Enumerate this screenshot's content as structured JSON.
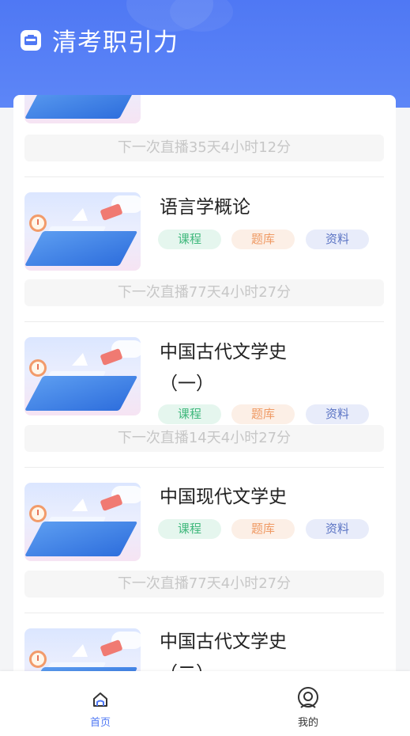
{
  "app": {
    "title": "清考职引力"
  },
  "first_countdown": "下一次直播35天4小时12分",
  "courses": [
    {
      "title": "语言学概论",
      "tags": [
        "课程",
        "题库",
        "资料"
      ],
      "countdown": "下一次直播77天4小时27分"
    },
    {
      "title": "中国古代文学史（一）",
      "tags": [
        "课程",
        "题库",
        "资料"
      ],
      "countdown": "下一次直播14天4小时27分"
    },
    {
      "title": "中国现代文学史",
      "tags": [
        "课程",
        "题库",
        "资料"
      ],
      "countdown": "下一次直播77天4小时27分"
    },
    {
      "title": "中国古代文学史（二）"
    }
  ],
  "nav": {
    "home": "首页",
    "me": "我的"
  },
  "colors": {
    "primary": "#4f78f4",
    "tag_course": "#3fb87c",
    "tag_quiz": "#ef9a64",
    "tag_doc": "#5b74c4"
  }
}
